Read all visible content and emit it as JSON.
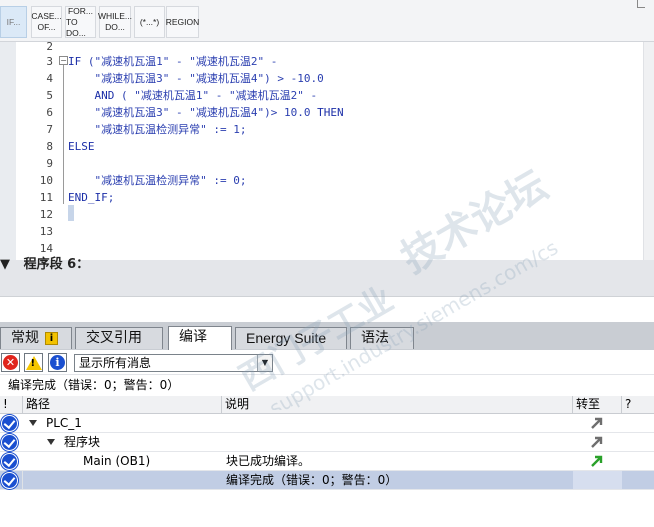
{
  "toolbar": {
    "buttons": [
      {
        "id": "if",
        "line1": "IF...",
        "line2": ""
      },
      {
        "id": "case",
        "line1": "CASE...",
        "line2": "OF..."
      },
      {
        "id": "for",
        "line1": "FOR...",
        "line2": "TO DO..."
      },
      {
        "id": "while",
        "line1": "WHILE...",
        "line2": "DO..."
      },
      {
        "id": "comment",
        "line1": "(*...*)",
        "line2": ""
      },
      {
        "id": "region",
        "line1": "REGION",
        "line2": ""
      }
    ]
  },
  "editor": {
    "line_numbers": [
      "2",
      "3",
      "4",
      "5",
      "6",
      "7",
      "8",
      "9",
      "10",
      "11",
      "12",
      "13",
      "14"
    ],
    "code_lines": [
      "",
      "IF (\"减速机瓦温1\" - \"减速机瓦温2\" -",
      "    \"减速机瓦温3\" - \"减速机瓦温4\") > -10.0",
      "    AND ( \"减速机瓦温1\" - \"减速机瓦温2\" -",
      "    \"减速机瓦温3\" - \"减速机瓦温4\")> 10.0 THEN",
      "    \"减速机瓦温检测异常\" := 1;",
      "ELSE",
      "",
      "    \"减速机瓦温检测异常\" := 0;",
      "END_IF;",
      "",
      "",
      ""
    ],
    "colors": {
      "keyword": "#1c2fa8",
      "text": "#2b3fb0"
    }
  },
  "network": {
    "title": "▼   程序段 6："
  },
  "tabs": {
    "general": "常规",
    "cross_reference": "交叉引用",
    "compile": "编译",
    "energy_suite": "Energy Suite",
    "syntax": "语法"
  },
  "filter": {
    "errors_icon": "error-filter-icon",
    "warnings_icon": "warning-filter-icon",
    "info_icon": "info-filter-icon",
    "selected": "显示所有消息"
  },
  "summary": "编译完成（错误：0；警告：0）",
  "table": {
    "headers": {
      "excl": "!",
      "path": "路径",
      "desc": "说明",
      "goto": "转至",
      "help": "?"
    },
    "rows": [
      {
        "path": "PLC_1",
        "desc": "",
        "goto": "grey"
      },
      {
        "path": "程序块",
        "desc": "",
        "goto": "grey"
      },
      {
        "path": "Main (OB1)",
        "desc": "块已成功编译。",
        "goto": "green"
      },
      {
        "path": "",
        "desc": "编译完成（错误：0；警告：0）",
        "goto": ""
      }
    ]
  },
  "watermark": {
    "line1": "西门子工业",
    "line2": "技术论坛",
    "line3": "support.industry.siemens.com/cs"
  }
}
